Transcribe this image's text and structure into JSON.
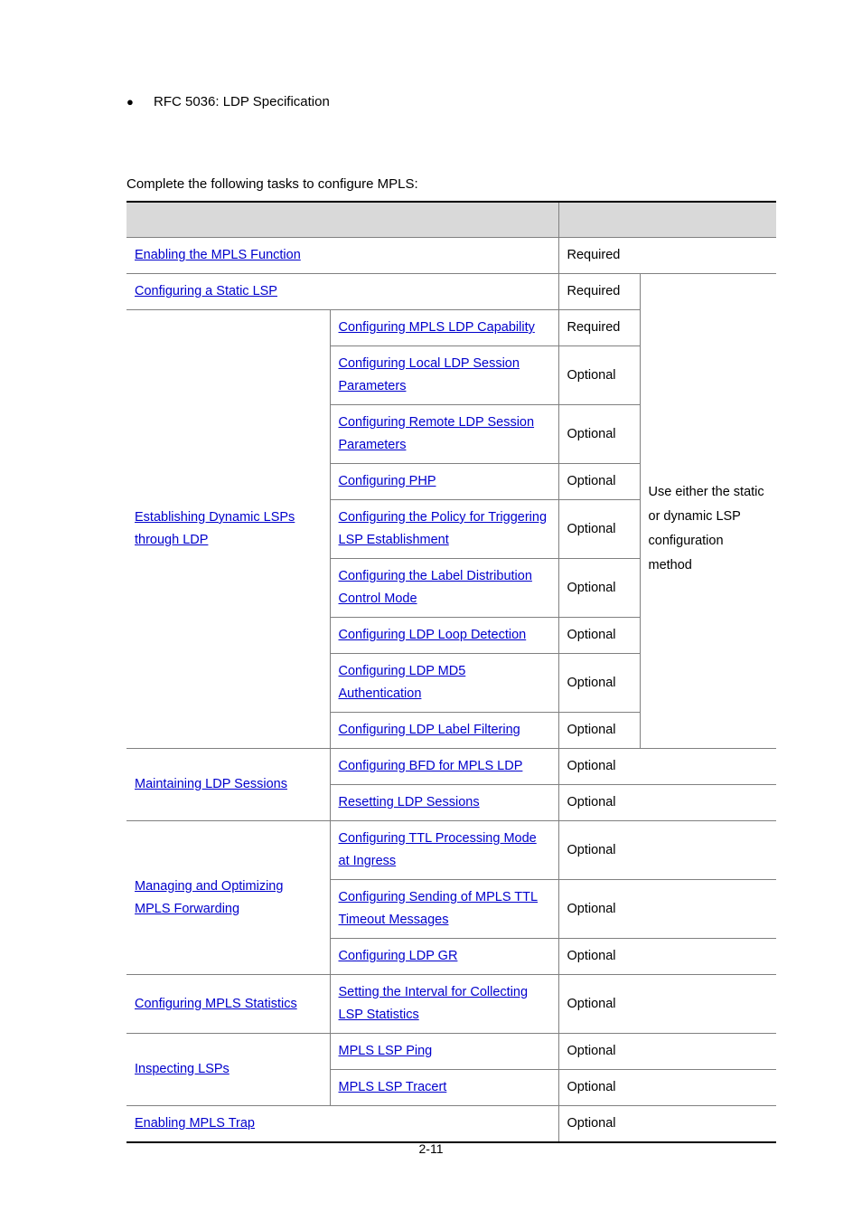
{
  "document": {
    "bullet": {
      "marker": "●",
      "text": "RFC 5036: LDP Specification"
    },
    "intro": "Complete the following tasks to configure MPLS:",
    "footer": "2-11",
    "link_color": "#0000cc",
    "header_fill": "#d9d9d9",
    "border_color": "#808080"
  },
  "table": {
    "header": {
      "col1": "",
      "col2": "",
      "col3": "",
      "col4": ""
    },
    "rows": [
      {
        "task": "Enabling the MPLS Function",
        "subtask": null,
        "requirement": "Required",
        "remarks": null
      },
      {
        "task": "Configuring a Static LSP",
        "subtask": null,
        "requirement": "Required",
        "remarks": null
      },
      {
        "task": "Establishing Dynamic LSPs through LDP",
        "subtask": "Configuring MPLS LDP Capability",
        "requirement": "Required",
        "remarks": "Use either the static or dynamic LSP configuration method"
      },
      {
        "task": null,
        "subtask": "Configuring Local LDP Session Parameters",
        "requirement": "Optional",
        "remarks": null
      },
      {
        "task": null,
        "subtask": "Configuring Remote LDP Session Parameters",
        "requirement": "Optional",
        "remarks": null
      },
      {
        "task": null,
        "subtask": "Configuring PHP",
        "requirement": "Optional",
        "remarks": null
      },
      {
        "task": null,
        "subtask": "Configuring the Policy for Triggering LSP Establishment",
        "requirement": "Optional",
        "remarks": null
      },
      {
        "task": null,
        "subtask": "Configuring the Label Distribution Control Mode",
        "requirement": "Optional",
        "remarks": null
      },
      {
        "task": null,
        "subtask": "Configuring LDP Loop Detection",
        "requirement": "Optional",
        "remarks": null
      },
      {
        "task": null,
        "subtask": "Configuring LDP MD5 Authentication",
        "requirement": "Optional",
        "remarks": null
      },
      {
        "task": null,
        "subtask": "Configuring LDP Label Filtering",
        "requirement": "Optional",
        "remarks": null
      },
      {
        "task": "Maintaining LDP Sessions",
        "subtask": "Configuring BFD for MPLS LDP",
        "requirement": "Optional",
        "remarks": null
      },
      {
        "task": null,
        "subtask": "Resetting LDP Sessions",
        "requirement": "Optional",
        "remarks": null
      },
      {
        "task": "Managing and Optimizing MPLS Forwarding",
        "subtask": "Configuring TTL Processing Mode at Ingress",
        "requirement": "Optional",
        "remarks": null
      },
      {
        "task": null,
        "subtask": "Configuring Sending of MPLS TTL Timeout Messages",
        "requirement": "Optional",
        "remarks": null
      },
      {
        "task": null,
        "subtask": "Configuring LDP GR",
        "requirement": "Optional",
        "remarks": null
      },
      {
        "task": "Configuring MPLS Statistics",
        "subtask": "Setting the Interval for Collecting LSP Statistics",
        "requirement": "Optional",
        "remarks": null
      },
      {
        "task": "Inspecting LSPs",
        "subtask": "MPLS LSP Ping",
        "requirement": "Optional",
        "remarks": null
      },
      {
        "task": null,
        "subtask": "MPLS LSP Tracert",
        "requirement": "Optional",
        "remarks": null
      },
      {
        "task": "Enabling MPLS Trap",
        "subtask": null,
        "requirement": "Optional",
        "remarks": null
      }
    ],
    "remark_text": "Use either the static or dynamic LSP configuration method"
  }
}
